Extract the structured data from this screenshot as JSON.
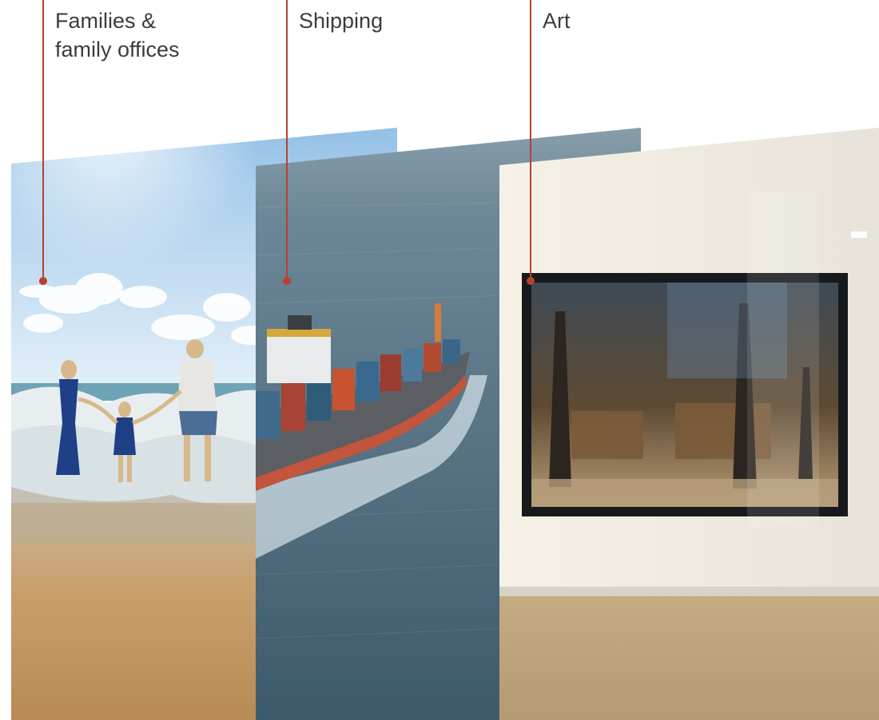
{
  "sectors": [
    {
      "label": "Families &\nfamily offices",
      "image": "family-on-beach"
    },
    {
      "label": "Shipping",
      "image": "container-ship-at-sea"
    },
    {
      "label": "Art",
      "image": "framed-artwork-in-gallery"
    }
  ],
  "colors": {
    "accent": "#b7412f",
    "label_text": "#3c3c3c",
    "background": "#ffffff"
  }
}
